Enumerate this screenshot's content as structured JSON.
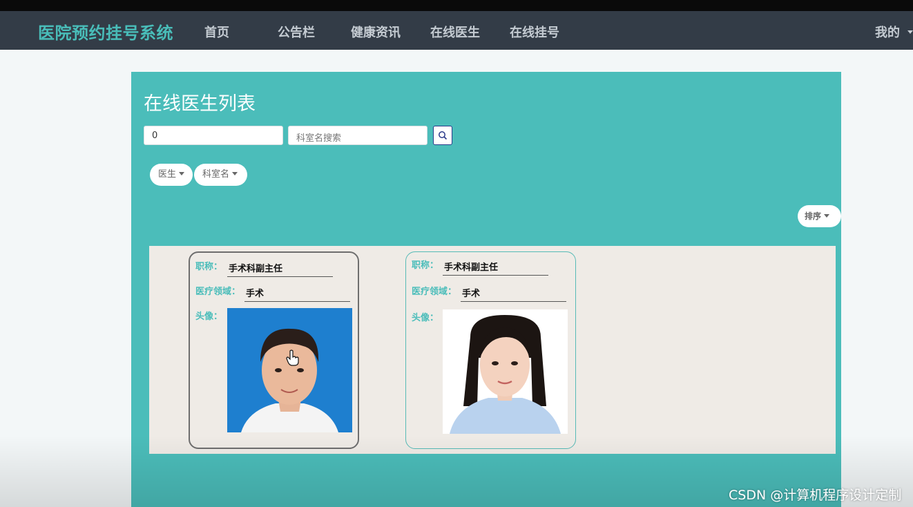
{
  "header": {
    "brand": "医院预约挂号系统",
    "nav": [
      "首页",
      "公告栏",
      "健康资讯",
      "在线医生",
      "在线挂号"
    ],
    "mine_label": "我的"
  },
  "page": {
    "title": "在线医生列表",
    "search": {
      "field1_value": "0",
      "field2_placeholder": "科室名搜索"
    },
    "filters": [
      {
        "label": "医生"
      },
      {
        "label": "科室名"
      }
    ],
    "sort_label": "排序"
  },
  "doctors": [
    {
      "title_label": "职称：",
      "title_value": "手术科副主任",
      "field_label": "医疗领域：",
      "field_value": "手术",
      "avatar_label": "头像：",
      "photo_bg": "#1e7fcf",
      "shirt_color": "#f4f4f4"
    },
    {
      "title_label": "职称：",
      "title_value": "手术科副主任",
      "field_label": "医疗领域：",
      "field_value": "手术",
      "avatar_label": "头像：",
      "photo_bg": "#ffffff",
      "shirt_color": "#b9d2ee"
    }
  ],
  "watermark": "CSDN @计算机程序设计定制",
  "colors": {
    "accent": "#4bbdba",
    "navbar": "#333c47"
  }
}
